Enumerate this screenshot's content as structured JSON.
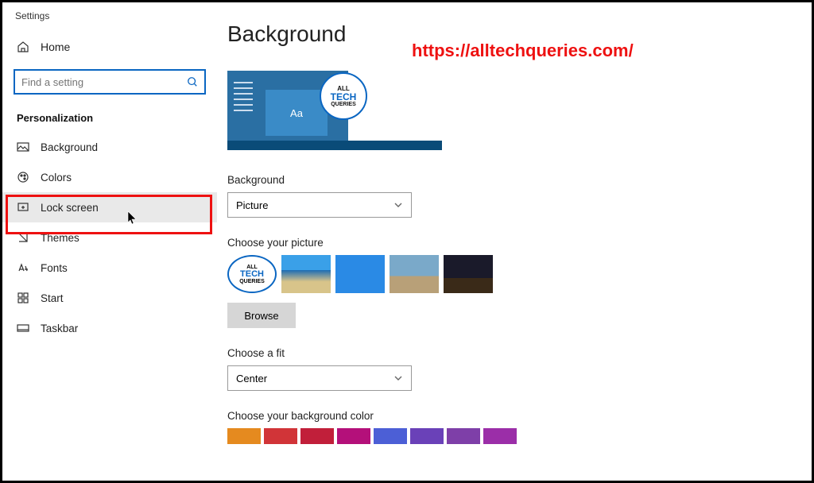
{
  "app_title": "Settings",
  "home_label": "Home",
  "search": {
    "placeholder": "Find a setting"
  },
  "section": "Personalization",
  "nav": [
    {
      "label": "Background"
    },
    {
      "label": "Colors"
    },
    {
      "label": "Lock screen"
    },
    {
      "label": "Themes"
    },
    {
      "label": "Fonts"
    },
    {
      "label": "Start"
    },
    {
      "label": "Taskbar"
    }
  ],
  "page_title": "Background",
  "watermark": "https://alltechqueries.com/",
  "preview_aa": "Aa",
  "logo": {
    "l1": "ALL",
    "l2": "TECH",
    "l3": "QUERIES"
  },
  "bg_label": "Background",
  "bg_value": "Picture",
  "choose_picture_label": "Choose your picture",
  "browse_label": "Browse",
  "fit_label": "Choose a fit",
  "fit_value": "Center",
  "color_label": "Choose your background color",
  "colors": [
    "#e58a1f",
    "#d13438",
    "#c11f3a",
    "#b4107a",
    "#4c5fd6",
    "#6a41b8",
    "#7e3fa8",
    "#9b2ea8"
  ]
}
